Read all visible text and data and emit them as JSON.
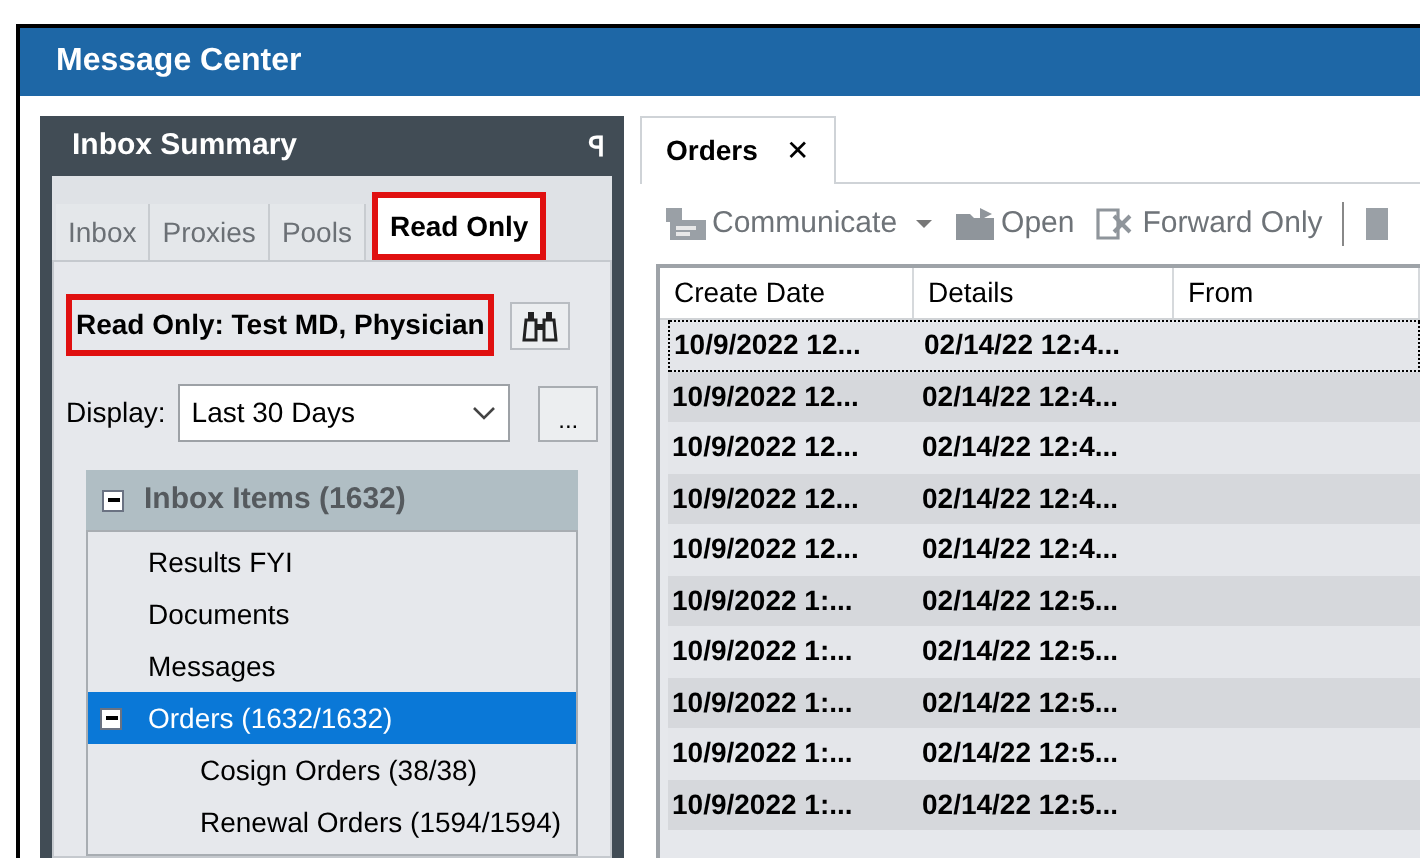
{
  "window": {
    "title": "Message Center"
  },
  "inbox_summary": {
    "title": "Inbox Summary",
    "pin": "ꟼ",
    "tabs": [
      {
        "label": "Inbox",
        "selected": false,
        "highlighted": false
      },
      {
        "label": "Proxies",
        "selected": false,
        "highlighted": false
      },
      {
        "label": "Pools",
        "selected": false,
        "highlighted": false
      },
      {
        "label": "Read Only",
        "selected": true,
        "highlighted": true
      }
    ],
    "owner": {
      "text": "Read Only: Test MD, Physician",
      "highlighted": true
    },
    "display": {
      "label": "Display:",
      "value": "Last 30 Days",
      "more": "..."
    },
    "tree": {
      "label": "Inbox Items (1632)",
      "expanded": true,
      "children": [
        {
          "label": "Results FYI",
          "selected": false
        },
        {
          "label": "Documents",
          "selected": false
        },
        {
          "label": "Messages",
          "selected": false
        },
        {
          "label": "Orders (1632/1632)",
          "selected": true,
          "expanded": true,
          "children": [
            {
              "label": "Cosign Orders (38/38)",
              "selected": false
            },
            {
              "label": "Renewal Orders (1594/1594)",
              "selected": false
            }
          ]
        }
      ]
    }
  },
  "orders": {
    "tab": {
      "label": "Orders",
      "close": "✕"
    },
    "toolbar": [
      {
        "kind": "communicate",
        "label": "Communicate",
        "dropdown": true,
        "disabled": true
      },
      {
        "kind": "open",
        "label": "Open",
        "dropdown": false,
        "disabled": true
      },
      {
        "kind": "forward",
        "label": "Forward Only",
        "dropdown": false,
        "disabled": true
      }
    ],
    "table": {
      "columns": [
        "Create Date",
        "Details",
        "From"
      ],
      "rows": [
        {
          "cells": [
            "10/9/2022 12...",
            "02/14/22 12:4..."
          ],
          "focused": true
        },
        {
          "cells": [
            "10/9/2022 12...",
            "02/14/22 12:4..."
          ],
          "focused": false
        },
        {
          "cells": [
            "10/9/2022 12...",
            "02/14/22 12:4..."
          ],
          "focused": false
        },
        {
          "cells": [
            "10/9/2022 12...",
            "02/14/22 12:4..."
          ],
          "focused": false
        },
        {
          "cells": [
            "10/9/2022 12...",
            "02/14/22 12:4..."
          ],
          "focused": false
        },
        {
          "cells": [
            "10/9/2022 1:...",
            "02/14/22 12:5..."
          ],
          "focused": false
        },
        {
          "cells": [
            "10/9/2022 1:...",
            "02/14/22 12:5..."
          ],
          "focused": false
        },
        {
          "cells": [
            "10/9/2022 1:...",
            "02/14/22 12:5..."
          ],
          "focused": false
        },
        {
          "cells": [
            "10/9/2022 1:...",
            "02/14/22 12:5..."
          ],
          "focused": false
        },
        {
          "cells": [
            "10/9/2022 1:...",
            "02/14/22 12:5..."
          ],
          "focused": false
        }
      ]
    }
  }
}
